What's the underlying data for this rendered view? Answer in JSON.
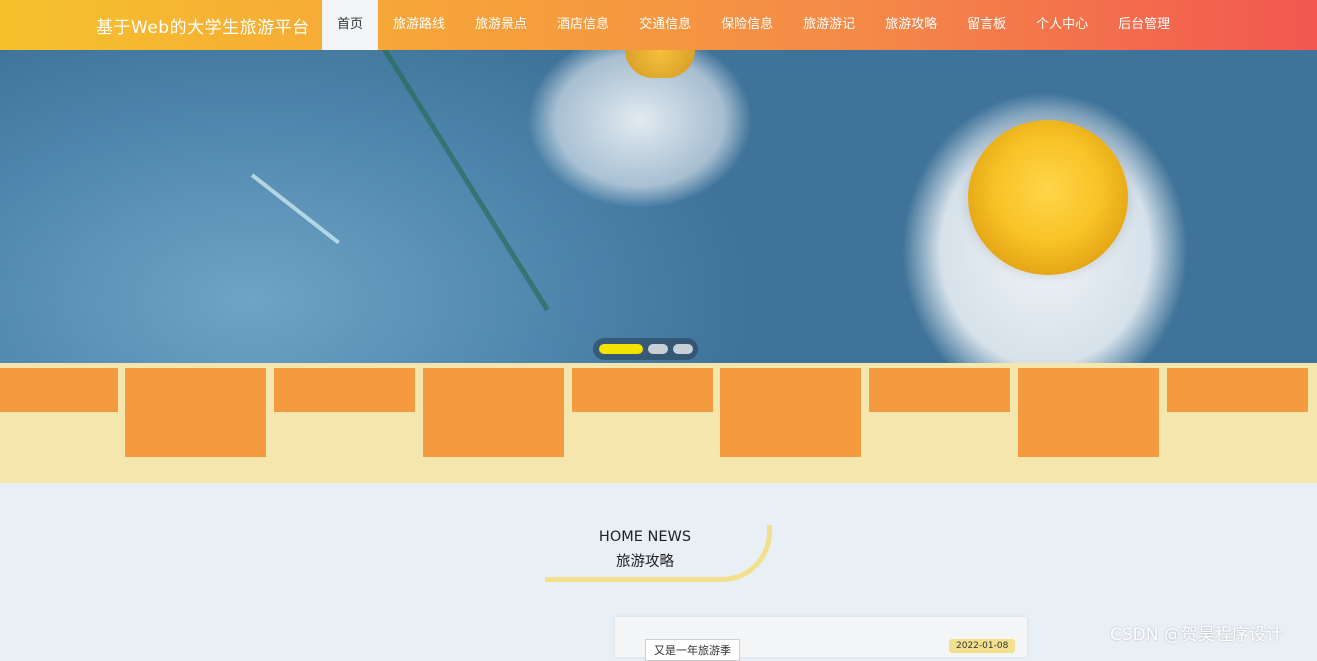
{
  "header": {
    "brand": "基于Web的大学生旅游平台",
    "nav": [
      {
        "label": "首页",
        "active": true
      },
      {
        "label": "旅游路线",
        "active": false
      },
      {
        "label": "旅游景点",
        "active": false
      },
      {
        "label": "酒店信息",
        "active": false
      },
      {
        "label": "交通信息",
        "active": false
      },
      {
        "label": "保险信息",
        "active": false
      },
      {
        "label": "旅游游记",
        "active": false
      },
      {
        "label": "旅游攻略",
        "active": false
      },
      {
        "label": "留言板",
        "active": false
      },
      {
        "label": "个人中心",
        "active": false
      },
      {
        "label": "后台管理",
        "active": false
      }
    ]
  },
  "banner": {
    "slide_count": 3,
    "active_slide": 1
  },
  "colors": {
    "header_start": "#f5c22c",
    "header_end": "#f2574f",
    "tile": "#f39b3e",
    "tiles_band": "#f4e6ac",
    "indicator_active": "#f2e300"
  },
  "section": {
    "title_en": "HOME NEWS",
    "title_cn": "旅游攻略"
  },
  "news": {
    "first_title": "又是一年旅游季",
    "first_date": "2022-01-08"
  },
  "watermark": "CSDN @贺昊程序设计"
}
